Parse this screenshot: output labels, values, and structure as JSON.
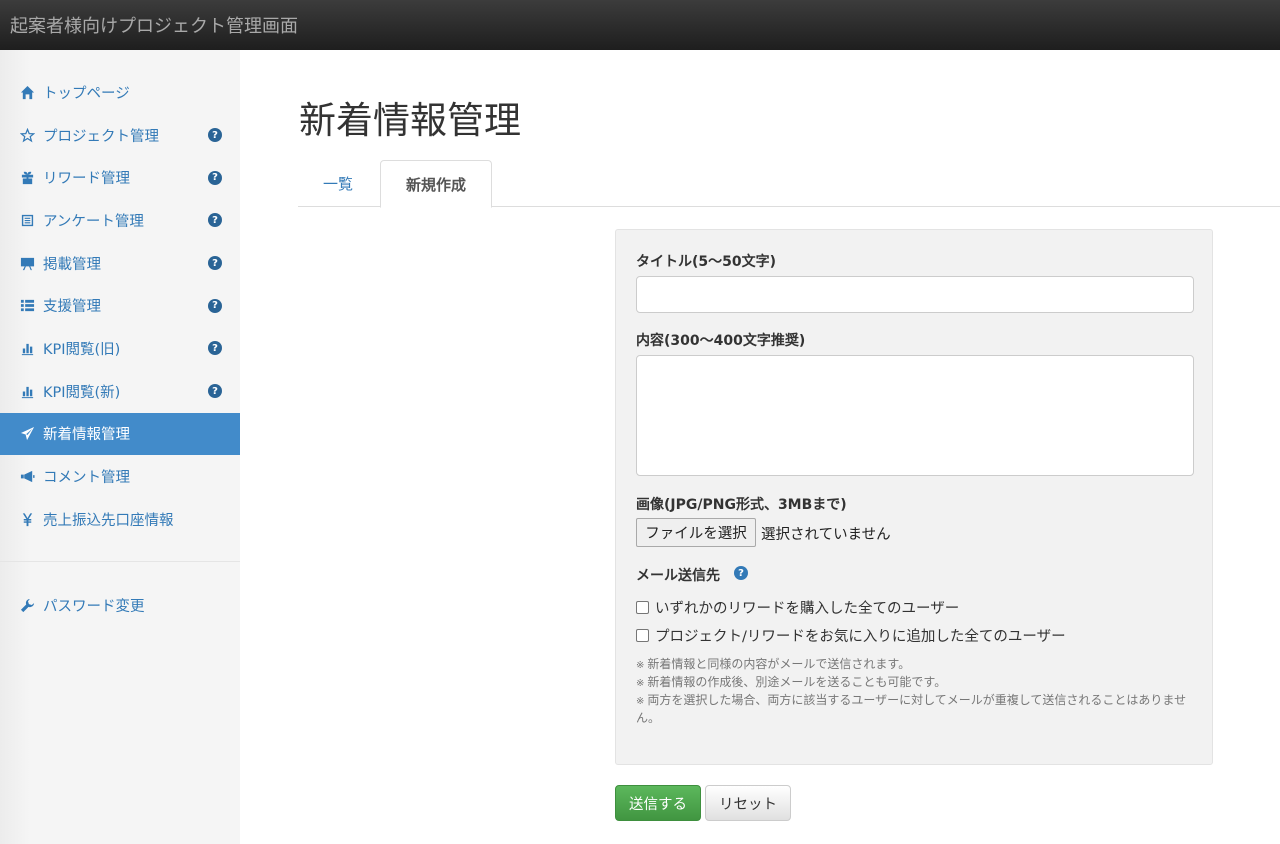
{
  "app": {
    "title": "起案者様向けプロジェクト管理画面"
  },
  "sidebar": {
    "items": [
      {
        "label": "トップページ",
        "icon": "home-icon",
        "help": false,
        "active": false
      },
      {
        "label": "プロジェクト管理",
        "icon": "star-icon",
        "help": true,
        "active": false
      },
      {
        "label": "リワード管理",
        "icon": "gift-icon",
        "help": true,
        "active": false
      },
      {
        "label": "アンケート管理",
        "icon": "list-alt-icon",
        "help": true,
        "active": false
      },
      {
        "label": "掲載管理",
        "icon": "blackboard-icon",
        "help": true,
        "active": false
      },
      {
        "label": "支援管理",
        "icon": "th-list-icon",
        "help": true,
        "active": false
      },
      {
        "label": "KPI閲覧(旧)",
        "icon": "stats-icon",
        "help": true,
        "active": false
      },
      {
        "label": "KPI閲覧(新)",
        "icon": "stats-icon",
        "help": true,
        "active": false
      },
      {
        "label": "新着情報管理",
        "icon": "send-icon",
        "help": false,
        "active": true
      },
      {
        "label": "コメント管理",
        "icon": "bullhorn-icon",
        "help": false,
        "active": false
      },
      {
        "label": "売上振込先口座情報",
        "icon": "yen-icon",
        "help": false,
        "active": false
      }
    ],
    "secondary": [
      {
        "label": "パスワード変更",
        "icon": "wrench-icon"
      }
    ],
    "help_glyph": "?"
  },
  "main": {
    "title": "新着情報管理",
    "tabs": [
      {
        "label": "一覧",
        "active": false
      },
      {
        "label": "新規作成",
        "active": true
      }
    ],
    "form": {
      "title_label": "タイトル(5〜50文字)",
      "title_value": "",
      "content_label": "内容(300〜400文字推奨)",
      "content_value": "",
      "image_label": "画像(JPG/PNG形式、3MBまで)",
      "file_button": "ファイルを選択",
      "file_status": "選択されていません",
      "mail_label": "メール送信先",
      "checkboxes": [
        {
          "label": "いずれかのリワードを購入した全てのユーザー",
          "checked": false
        },
        {
          "label": "プロジェクト/リワードをお気に入りに追加した全てのユーザー",
          "checked": false
        }
      ],
      "note_mark": "※",
      "notes": [
        "新着情報と同様の内容がメールで送信されます。",
        "新着情報の作成後、別途メールを送ることも可能です。",
        "両方を選択した場合、両方に該当するユーザーに対してメールが重複して送信されることはありません。"
      ]
    },
    "buttons": {
      "submit": "送信する",
      "reset": "リセット"
    }
  },
  "colors": {
    "accent": "#337ab7",
    "active_bg": "#428bca",
    "submit": "#5cb85c",
    "topbar": "#222222"
  }
}
